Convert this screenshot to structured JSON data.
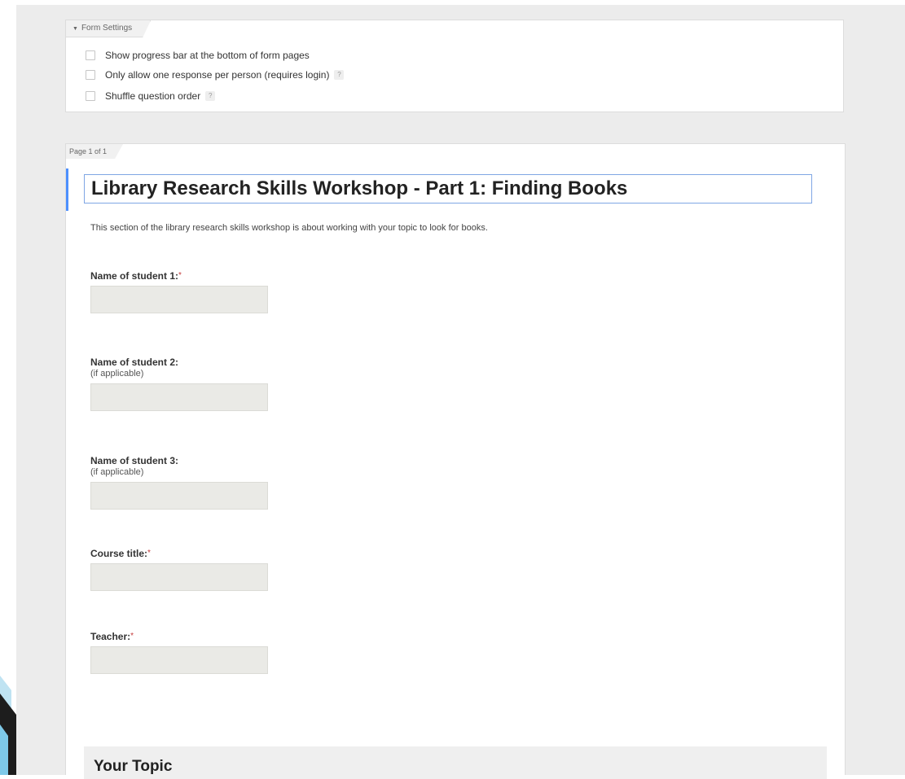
{
  "form_settings": {
    "tab_label": "Form Settings",
    "options": [
      {
        "label": "Show progress bar at the bottom of form pages",
        "checked": false,
        "help": ""
      },
      {
        "label": "Only allow one response per person (requires login)",
        "checked": false,
        "help": "?"
      },
      {
        "label": "Shuffle question order",
        "checked": false,
        "help": "?"
      }
    ]
  },
  "page": {
    "tab_label": "Page 1 of 1",
    "title": "Library Research Skills Workshop - Part 1: Finding Books",
    "description": "This section of the library research skills workshop is about working with your topic to look for books.",
    "questions": [
      {
        "label": "Name of student 1:",
        "required_mark": "*",
        "help": ""
      },
      {
        "label": "Name of student 2:",
        "required_mark": "",
        "help": "(if applicable)"
      },
      {
        "label": "Name of student 3:",
        "required_mark": "",
        "help": "(if applicable)"
      },
      {
        "label": "Course title:",
        "required_mark": "*",
        "help": ""
      },
      {
        "label": "Teacher:",
        "required_mark": "*",
        "help": ""
      }
    ],
    "section": {
      "title": "Your Topic"
    }
  },
  "colors": {
    "accent": "#4d90fe",
    "input_fill": "#eaeae6",
    "required": "#c43b3b",
    "canvas": "#ececec"
  }
}
